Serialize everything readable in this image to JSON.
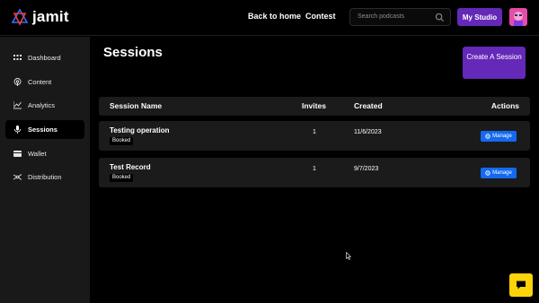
{
  "header": {
    "logo_text": "jamit",
    "nav": [
      "Back to home",
      "Contest"
    ],
    "search_placeholder": "Search podcasts",
    "studio_label": "My Studio"
  },
  "sidebar": {
    "items": [
      {
        "label": "Dashboard",
        "icon": "grid-icon"
      },
      {
        "label": "Content",
        "icon": "podcast-icon"
      },
      {
        "label": "Analytics",
        "icon": "chart-icon"
      },
      {
        "label": "Sessions",
        "icon": "microphone-icon",
        "active": true
      },
      {
        "label": "Wallet",
        "icon": "wallet-icon"
      },
      {
        "label": "Distribution",
        "icon": "distribution-icon"
      }
    ]
  },
  "main": {
    "title": "Sessions",
    "create_label": "Create A Session",
    "columns": [
      "Session Name",
      "Invites",
      "Created",
      "Actions"
    ],
    "rows": [
      {
        "name": "Testing operation",
        "status": "Booked",
        "invites": "1",
        "created": "11/6/2023",
        "action": "Manage"
      },
      {
        "name": "Test Record",
        "status": "Booked",
        "invites": "1",
        "created": "9/7/2023",
        "action": "Manage"
      }
    ]
  },
  "colors": {
    "accent": "#6429b8",
    "manage": "#1469f0",
    "chat": "#fcd20a",
    "panel": "#1b1b1b",
    "sidebar": "#191919"
  }
}
